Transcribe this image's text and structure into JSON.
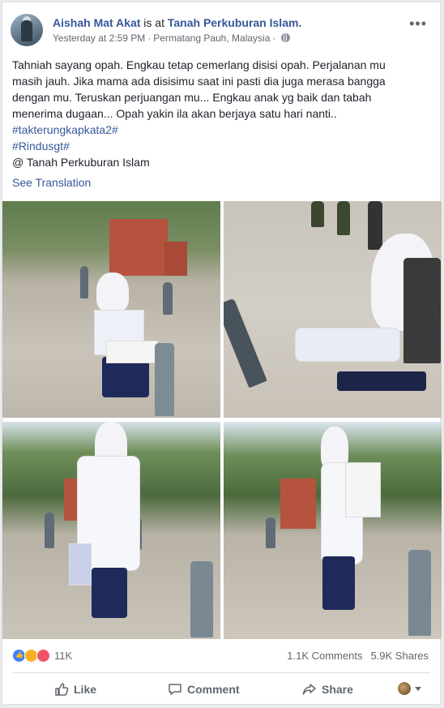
{
  "post": {
    "author": "Aishah Mat Akat",
    "activity": "is at",
    "location": "Tanah Perkuburan Islam.",
    "timestamp": "Yesterday at 2:59 PM",
    "place": "Permatang Pauh, Malaysia",
    "separator": "·",
    "more_icon": "more-options-icon",
    "text_lines": [
      "Tahniah sayang opah. Engkau tetap cemerlang disisi opah. Perjalanan mu",
      "masih jauh. Jika mama ada disisimu saat ini pasti dia juga merasa bangga",
      "dengan mu. Teruskan perjuangan mu... Engkau anak yg baik dan tabah",
      "menerima dugaan... Opah yakin ila akan berjaya satu hari nanti.."
    ],
    "hashtags": [
      "#takterungkapkata2#",
      "#Rindusgt#"
    ],
    "checkin": "@ Tanah Perkuburan Islam",
    "see_translation": "See Translation"
  },
  "stats": {
    "reactions": [
      "like",
      "sad",
      "love"
    ],
    "reaction_count": "11K",
    "comments": "1.1K Comments",
    "shares": "5.9K Shares"
  },
  "actions": {
    "like": "Like",
    "comment": "Comment",
    "share": "Share"
  },
  "colors": {
    "link": "#365899",
    "secondary": "#606770",
    "background": "#e9ebee"
  }
}
